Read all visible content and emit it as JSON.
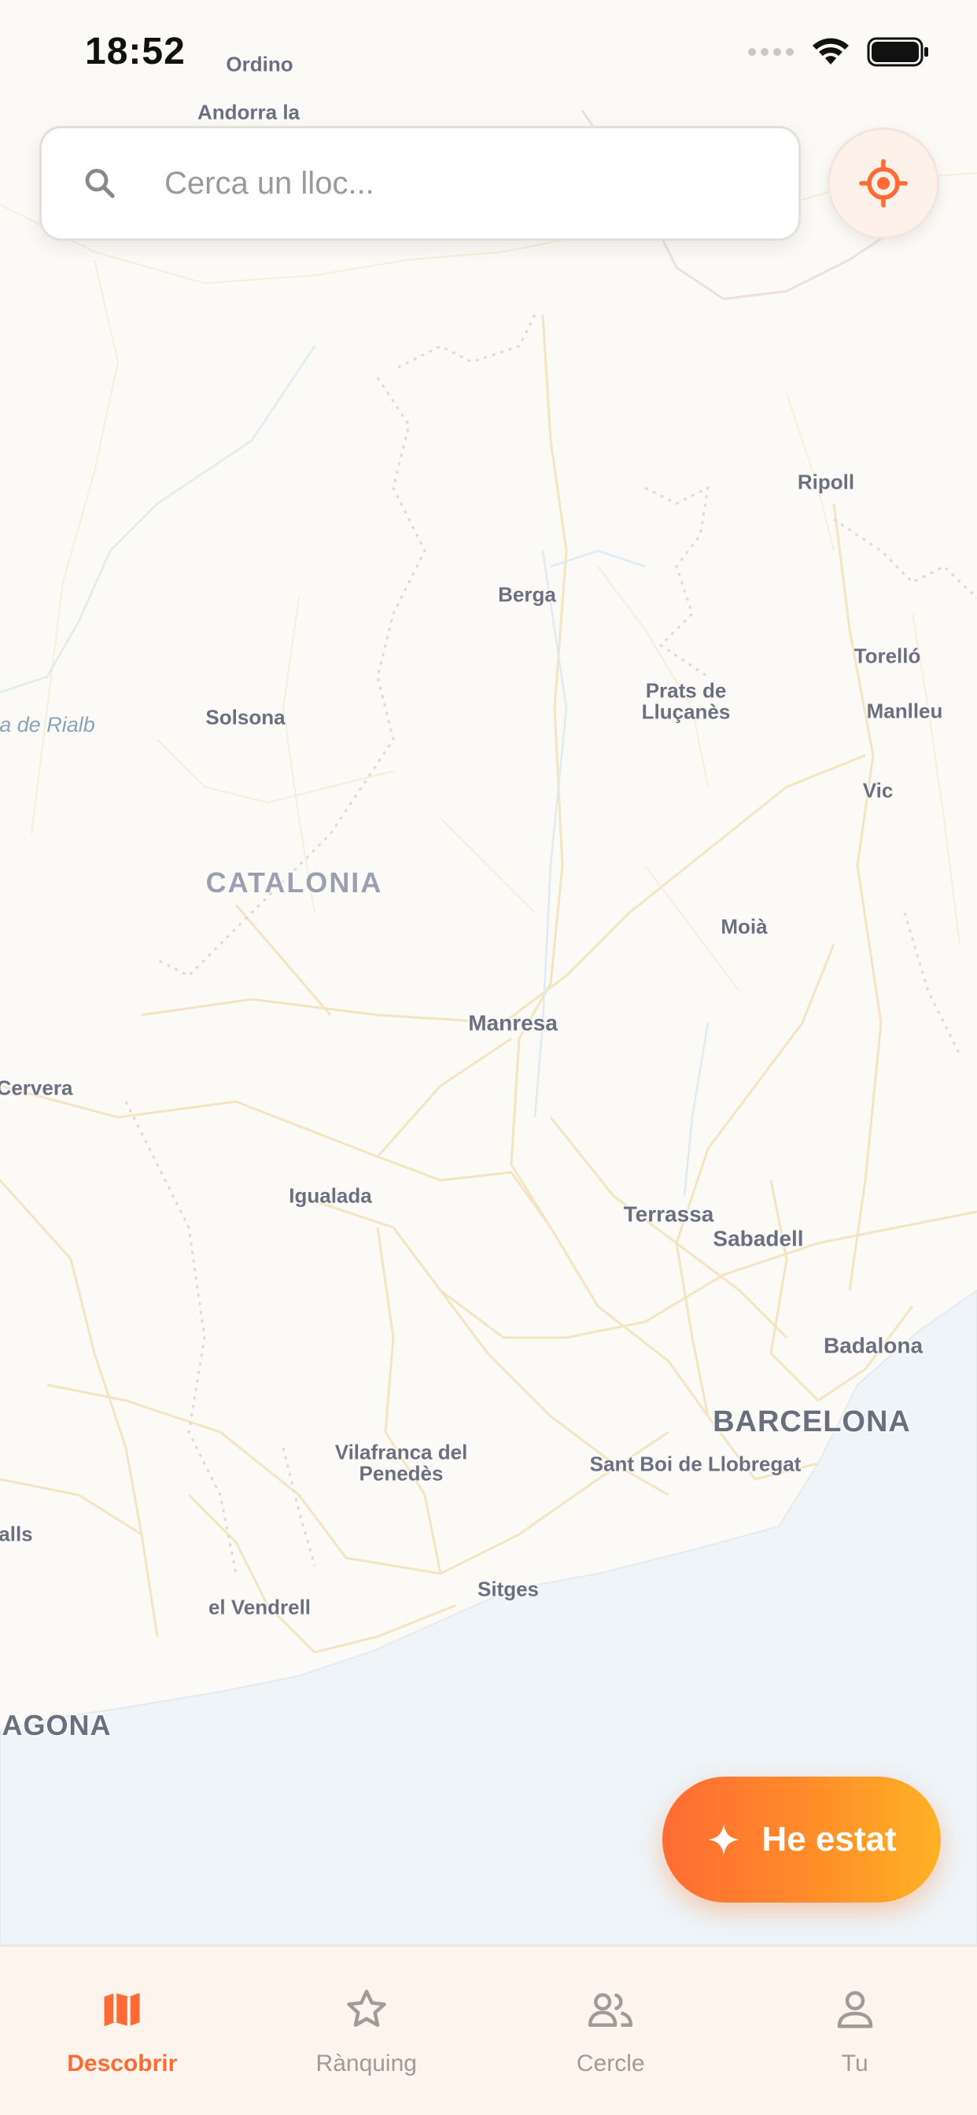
{
  "status_bar": {
    "time": "18:52"
  },
  "search": {
    "placeholder": "Cerca un lloc..."
  },
  "map": {
    "places": {
      "ordino": "Ordino",
      "andorra": "Andorra la",
      "ripoll": "Ripoll",
      "berga": "Berga",
      "torello": "Torelló",
      "prats": "Prats de\nLluçanès",
      "manlleu": "Manlleu",
      "rialb": "a de Rialb",
      "solsona": "Solsona",
      "vic": "Vic",
      "catalonia": "CATALONIA",
      "moia": "Moià",
      "manresa": "Manresa",
      "cervera": "Cervera",
      "igualada": "Igualada",
      "terrassa": "Terrassa",
      "sabadell": "Sabadell",
      "badalona": "Badalona",
      "barcelona": "BARCELONA",
      "vilafranca": "Vilafranca del\nPenedès",
      "santboi": "Sant Boi de Llobregat",
      "valls": "Valls",
      "sitges": "Sitges",
      "vendrell": "el Vendrell",
      "tarragona": "AGONA"
    }
  },
  "fab": {
    "label": "He estat"
  },
  "tabs": [
    {
      "label": "Descobrir",
      "icon": "map-icon",
      "active": true
    },
    {
      "label": "Rànquing",
      "icon": "star-icon",
      "active": false
    },
    {
      "label": "Cercle",
      "icon": "people-icon",
      "active": false
    },
    {
      "label": "Tu",
      "icon": "person-icon",
      "active": false
    }
  ],
  "colors": {
    "accent": "#ff6b34",
    "fab_gradient_end": "#ffb224",
    "tab_inactive": "#a09b97",
    "sea": "#eef4f8"
  }
}
